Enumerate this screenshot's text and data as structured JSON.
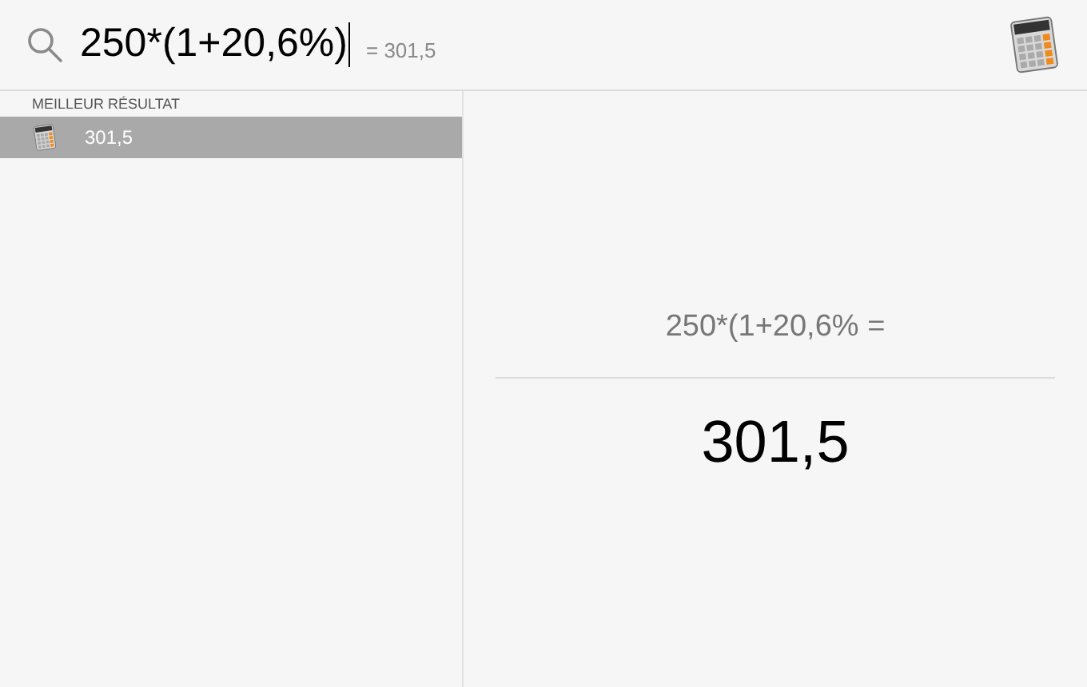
{
  "search": {
    "value": "250*(1+20,6%)",
    "completion": "= 301,5"
  },
  "sidebar": {
    "section": "MEILLEUR RÉSULTAT",
    "items": [
      {
        "label": "301,5",
        "selected": true
      }
    ]
  },
  "preview": {
    "expression": "250*(1+20,6% =",
    "result": "301,5"
  }
}
